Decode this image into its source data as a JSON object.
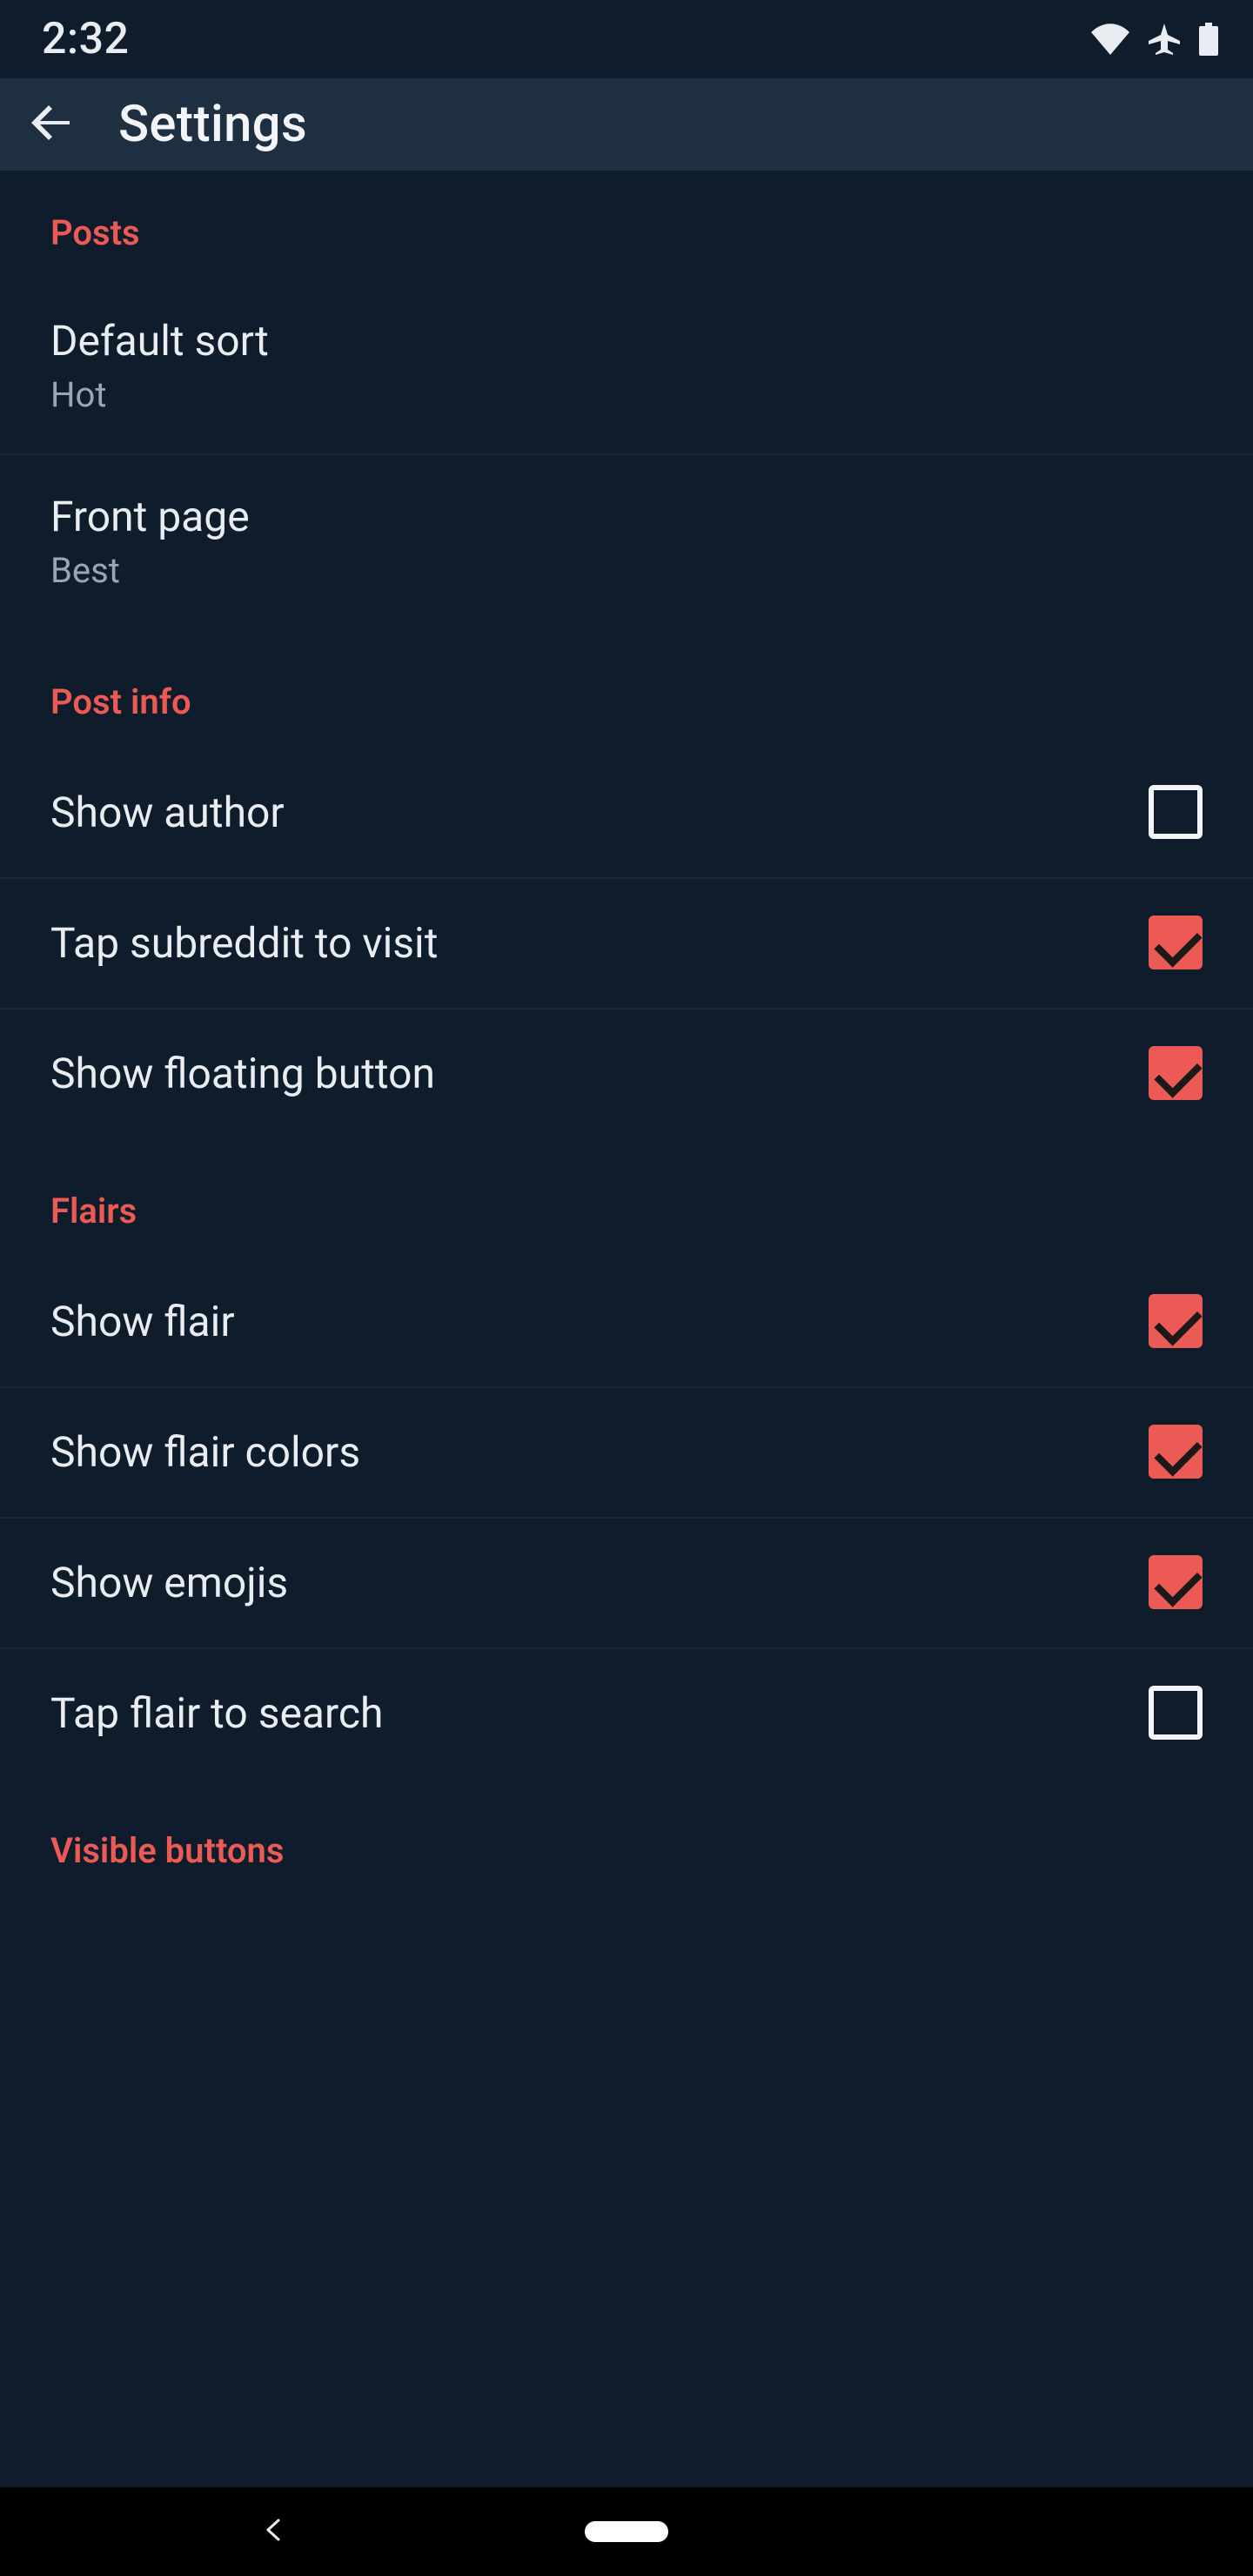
{
  "status": {
    "time": "2:32"
  },
  "appbar": {
    "title": "Settings"
  },
  "sections": {
    "posts": {
      "header": "Posts",
      "default_sort": {
        "title": "Default sort",
        "value": "Hot"
      },
      "front_page": {
        "title": "Front page",
        "value": "Best"
      }
    },
    "post_info": {
      "header": "Post info",
      "show_author": {
        "title": "Show author",
        "checked": false
      },
      "tap_subreddit": {
        "title": "Tap subreddit to visit",
        "checked": true
      },
      "floating_button": {
        "title": "Show floating button",
        "checked": true
      }
    },
    "flairs": {
      "header": "Flairs",
      "show_flair": {
        "title": "Show flair",
        "checked": true
      },
      "show_flair_colors": {
        "title": "Show flair colors",
        "checked": true
      },
      "show_emojis": {
        "title": "Show emojis",
        "checked": true
      },
      "tap_flair": {
        "title": "Tap flair to search",
        "checked": false
      }
    },
    "visible_buttons": {
      "header": "Visible buttons"
    }
  }
}
